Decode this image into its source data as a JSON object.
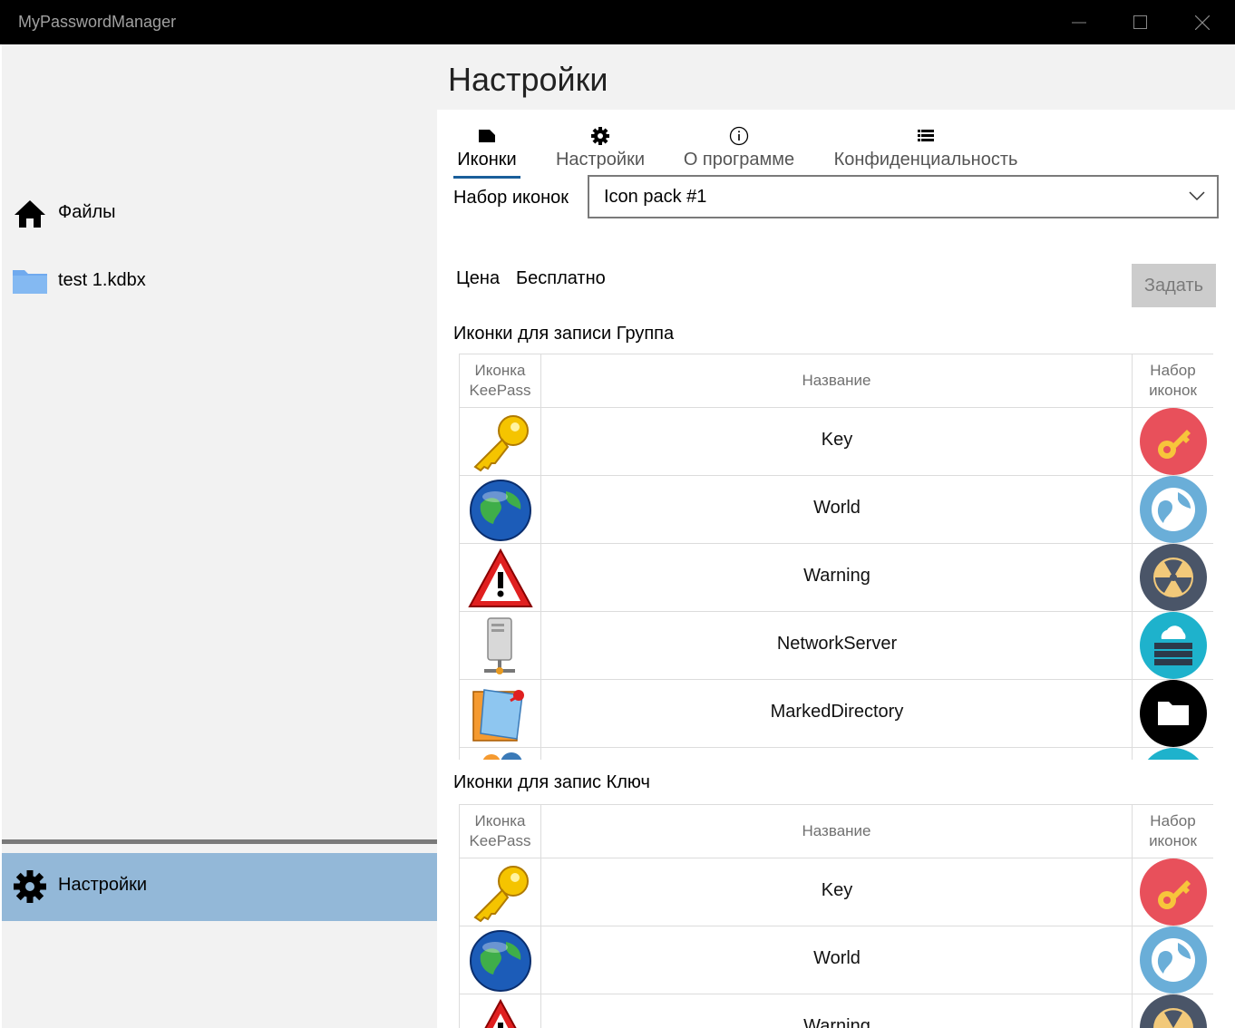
{
  "window": {
    "title": "MyPasswordManager"
  },
  "nav": {
    "items": [
      {
        "label": "Файлы",
        "icon": "home-icon"
      },
      {
        "label": "test 1.kdbx",
        "icon": "folder-icon"
      }
    ],
    "settings": {
      "label": "Настройки",
      "icon": "gear-icon"
    }
  },
  "page": {
    "title": "Настройки"
  },
  "tabs": [
    {
      "label": "Иконки",
      "icon": "label-icon",
      "active": true
    },
    {
      "label": "Настройки",
      "icon": "gear-icon",
      "active": false
    },
    {
      "label": "О программе",
      "icon": "info-icon",
      "active": false
    },
    {
      "label": "Конфиденциальность",
      "icon": "list-icon",
      "active": false
    }
  ],
  "icon_pack": {
    "label": "Набор иконок",
    "selected": "Icon pack #1"
  },
  "price": {
    "label": "Цена",
    "value": "Бесплатно"
  },
  "set_button": {
    "label": "Задать"
  },
  "columns": {
    "keepass": "Иконка KeePass",
    "name": "Название",
    "pack": "Набор иконок"
  },
  "group_section": {
    "title": "Иконки для записи Группа",
    "rows": [
      {
        "name": "Key"
      },
      {
        "name": "World"
      },
      {
        "name": "Warning"
      },
      {
        "name": "NetworkServer"
      },
      {
        "name": "MarkedDirectory"
      }
    ]
  },
  "key_section": {
    "title": "Иконки для запис Ключ",
    "rows": [
      {
        "name": "Key"
      },
      {
        "name": "World"
      },
      {
        "name": "Warning"
      }
    ]
  },
  "colors": {
    "nav_selected": "#93b8d8",
    "tab_underline": "#1a5e9a",
    "pack_key_bg": "#e8505b",
    "pack_world_bg": "#6aaed8",
    "pack_warning_bg": "#4a5568",
    "pack_server_bg": "#1eb2cc",
    "pack_folder_bg": "#000000"
  }
}
